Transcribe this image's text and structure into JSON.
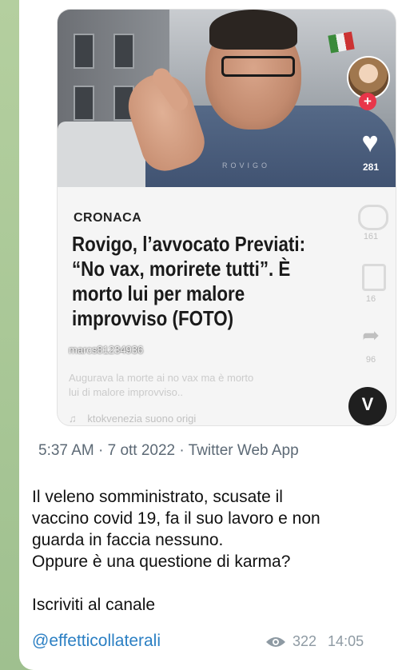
{
  "post": {
    "media": {
      "photo_watermark": "ROVIGO",
      "likes_count": "281",
      "ghost_counts": [
        "161",
        "16",
        "96"
      ],
      "article": {
        "section": "CRONACA",
        "headline_lines": [
          "Rovigo, l’avvocato Previati:",
          "“No vax, morirete tutti”. È",
          "morto lui per malore",
          "improvviso (FOTO)"
        ]
      },
      "overlay": {
        "username": "marcs81234936",
        "caption_lines": [
          "Augurava la morte ai no vax ma è morto",
          "lui di malore improvviso.."
        ],
        "music_note": "♫",
        "music_text": "ktokvenezia suono origi"
      }
    },
    "tweet_meta": "5:37 AM · 7 ott 2022 · Twitter Web App",
    "message_lines": [
      "Il veleno somministrato, scusate il",
      "vaccino covid 19, fa il suo lavoro e non",
      "guarda in faccia nessuno.",
      "Oppure è una questione di karma?"
    ],
    "subscribe_text": "Iscriviti al canale",
    "channel_link": "@effetticollaterali",
    "views": "322",
    "time": "14:05"
  }
}
